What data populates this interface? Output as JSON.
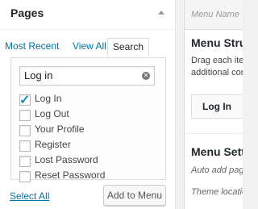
{
  "pages_box": {
    "title": "Pages",
    "tabs": [
      {
        "label": "Most Recent",
        "active": false
      },
      {
        "label": "View All",
        "active": false
      },
      {
        "label": "Search",
        "active": true
      }
    ],
    "search": {
      "value": "Log in"
    },
    "results": [
      {
        "label": "Log In",
        "checked": true
      },
      {
        "label": "Log Out",
        "checked": false
      },
      {
        "label": "Your Profile",
        "checked": false
      },
      {
        "label": "Register",
        "checked": false
      },
      {
        "label": "Lost Password",
        "checked": false
      },
      {
        "label": "Reset Password",
        "checked": false
      }
    ],
    "select_all_label": "Select All",
    "add_button_label": "Add to Menu"
  },
  "menu_panel": {
    "menu_name_placeholder": "Menu Name",
    "structure_title": "Menu Stru",
    "structure_desc_1": "Drag each iter",
    "structure_desc_2": "additional cor",
    "menu_item_label": "Log In",
    "settings_title": "Menu Setti",
    "auto_add_label": "Auto add page",
    "theme_location_label": "Theme locatio"
  },
  "colors": {
    "link": "#0073aa",
    "checkmark": "#1e8cbe"
  }
}
